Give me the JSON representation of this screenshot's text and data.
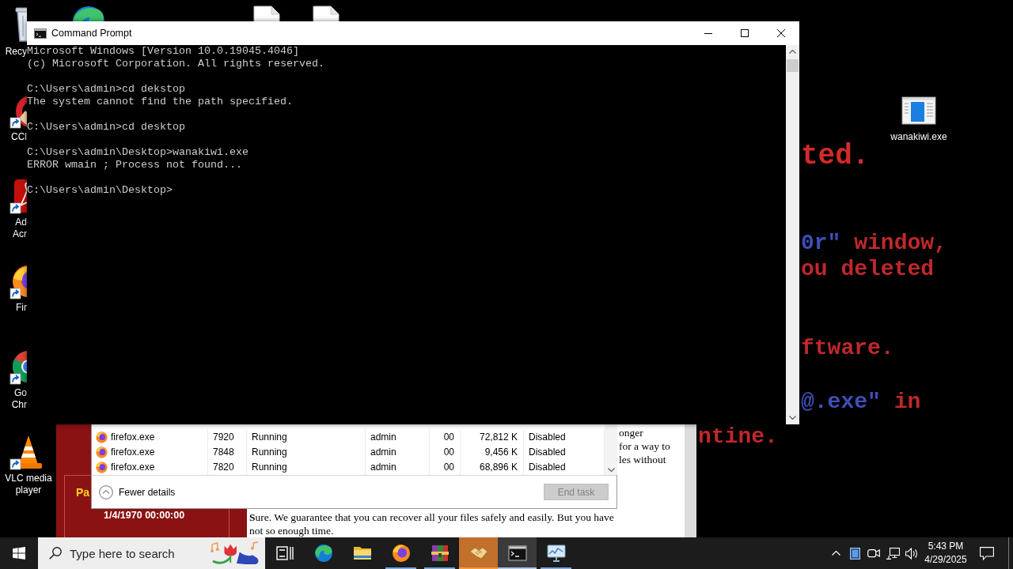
{
  "desktop": {
    "wallpaper": {
      "lines": [
        {
          "kind": "heading",
          "segments": [
            {
              "text": "ted.",
              "color": "#d42a2a"
            }
          ]
        },
        {
          "kind": "body",
          "segments": [
            {
              "text": "0r\"",
              "color": "#3f4fb8"
            },
            {
              "text": " window,",
              "color": "#c0282c"
            }
          ]
        },
        {
          "kind": "body",
          "segments": [
            {
              "text": "ou deleted",
              "color": "#c0282c"
            }
          ]
        },
        {
          "kind": "body",
          "segments": [
            {
              "text": "ftware.",
              "color": "#c0282c"
            }
          ]
        },
        {
          "kind": "body",
          "segments": [
            {
              "text": "@.exe\"",
              "color": "#3f4fb8"
            },
            {
              "text": " in",
              "color": "#c0282c"
            }
          ]
        },
        {
          "kind": "body",
          "segments": [
            {
              "text": "ntine.",
              "color": "#c0282c"
            }
          ]
        }
      ]
    },
    "left_column": [
      {
        "kind": "bin",
        "label_lines": [
          "Recy"
        ],
        "shortcut": false,
        "covered": true
      },
      {
        "kind": "cleaner",
        "label_lines": [
          "CCl"
        ],
        "shortcut": true,
        "covered": true
      },
      {
        "kind": "pdf",
        "label_lines": [
          "Ad",
          "Acr"
        ],
        "shortcut": true,
        "covered": true
      },
      {
        "kind": "firefox",
        "label_lines": [
          "Fir"
        ],
        "shortcut": true,
        "covered": true
      },
      {
        "kind": "chrome",
        "label_lines": [
          "Go",
          "Chr"
        ],
        "shortcut": true,
        "covered": true
      },
      {
        "kind": "cone",
        "label_lines": [
          "VLC media",
          "player"
        ],
        "shortcut": true,
        "covered": false
      }
    ],
    "top_row": [
      {
        "kind": "edge",
        "covered": true
      },
      {
        "kind": "file",
        "covered": true
      },
      {
        "kind": "file",
        "covered": true
      }
    ],
    "right_column": [
      {
        "kind": "program",
        "label_lines": [
          "wanakiwi.exe"
        ],
        "shortcut": false,
        "covered": false
      }
    ]
  },
  "console_window": {
    "title": "Command Prompt",
    "blocks": [
      [
        "Microsoft Windows [Version 10.0.19045.4046]",
        "(c) Microsoft Corporation. All rights reserved."
      ],
      [
        "C:\\Users\\admin>cd dekstop",
        "The system cannot find the path specified."
      ],
      [
        "C:\\Users\\admin>cd desktop"
      ],
      [
        "C:\\Users\\admin\\Desktop>wanakiwi.exe",
        "ERROR wmain ; Process not found..."
      ],
      [
        "C:\\Users\\admin\\Desktop>"
      ]
    ]
  },
  "task_manager": {
    "rows": [
      [
        "firefox.exe",
        "7920",
        "Running",
        "admin",
        "00",
        "72,812 K",
        "Disabled"
      ],
      [
        "firefox.exe",
        "7848",
        "Running",
        "admin",
        "00",
        "9,456 K",
        "Disabled"
      ],
      [
        "firefox.exe",
        "7820",
        "Running",
        "admin",
        "00",
        "68,896 K",
        "Disabled"
      ]
    ],
    "details_toggle": "Fewer details",
    "end_task": {
      "label": "End task",
      "disabled": true
    }
  },
  "decryptor_window": {
    "timer_label": "Pa",
    "timer_value": "1/4/1970 00:00:00",
    "side_lines": [
      "onger",
      "for a way to",
      "les without"
    ],
    "body_lines": [
      "**S**ure. We guarantee that you can recover all your files safely and easily. But you have",
      "not so enough time."
    ]
  },
  "taskbar": {
    "search": {
      "placeholder": "Type here to search"
    },
    "apps": [
      {
        "kind": "taskview",
        "running": false,
        "selected": false,
        "attention": false
      },
      {
        "kind": "edge",
        "running": false,
        "selected": false,
        "attention": false
      },
      {
        "kind": "folder",
        "running": false,
        "selected": false,
        "attention": false
      },
      {
        "kind": "firefox",
        "running": true,
        "selected": false,
        "attention": false
      },
      {
        "kind": "archive",
        "running": true,
        "selected": false,
        "attention": false
      },
      {
        "kind": "handshake",
        "running": true,
        "selected": false,
        "attention": true
      },
      {
        "kind": "terminal",
        "running": true,
        "selected": true,
        "attention": false
      },
      {
        "kind": "monitor",
        "running": true,
        "selected": false,
        "attention": false
      }
    ],
    "clock": {
      "time": "5:43 PM",
      "date": "4/29/2025"
    }
  }
}
